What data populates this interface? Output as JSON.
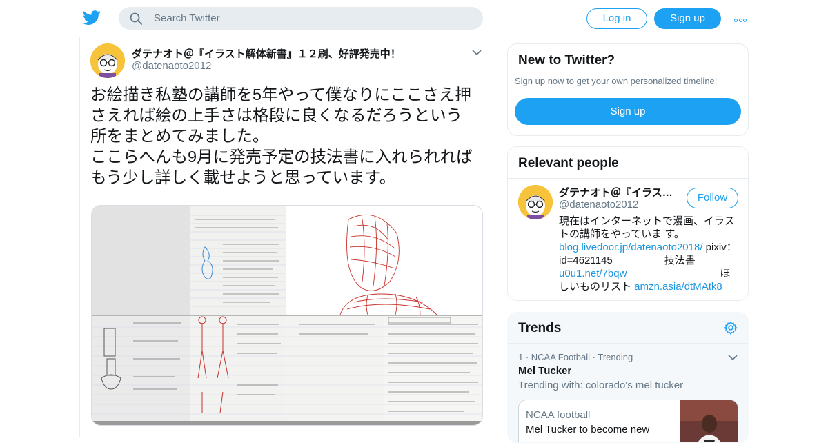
{
  "header": {
    "search_placeholder": "Search Twitter",
    "login_label": "Log in",
    "signup_label": "Sign up",
    "brand_color": "#1da1f2"
  },
  "tweet": {
    "author_name": "ダテナオト＠『イラスト解体新書』１２刷、好評発売中！",
    "author_handle": "@datenaoto2012",
    "text": "お絵描き私塾の講師を5年やって僕なりにここさえ押\nさえれば絵の上手さは格段に良くなるだろうという\n所をまとめてみました。\nここらへんも9月に発売予定の技法書に入れられれば\nもう少し詳しく載せようと思っています。"
  },
  "sidebar": {
    "new_to_twitter": {
      "title": "New to Twitter?",
      "subtitle": "Sign up now to get your own personalized timeline!",
      "button_label": "Sign up"
    },
    "relevant_people": {
      "title": "Relevant people",
      "name": "ダテナオト＠『イラス…",
      "handle": "@datenaoto2012",
      "follow_label": "Follow",
      "bio_text_1": "現在はインターネットで漫画、イラストの講師をやっていま す。",
      "bio_link_1": "blog.livedoor.jp/datenaoto2018/",
      "bio_text_2": " pixiv：id=4621145　　　　　技法書 ",
      "bio_link_2": "u0u1.net/7bqw",
      "bio_text_3": "　　　　　　　　　ほしいものリスト ",
      "bio_link_3": "amzn.asia/dtMAtk8"
    },
    "trends": {
      "title": "Trends",
      "meta": "1 · NCAA Football · Trending",
      "name": "Mel Tucker",
      "trending_with": "Trending with: colorado's mel tucker",
      "story_source": "NCAA football",
      "story_headline": "Mel Tucker to become new"
    }
  }
}
